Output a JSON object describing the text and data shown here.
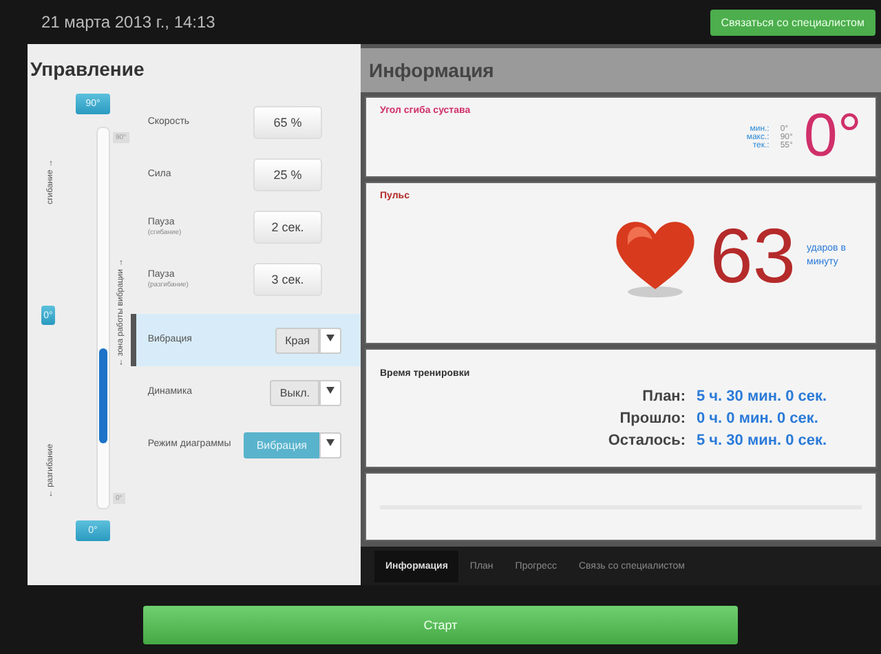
{
  "top_bar": {
    "datetime": "21 марта 2013 г., 14:13",
    "contact_button": "Связаться со специалистом"
  },
  "control": {
    "title": "Управление",
    "top_button": "90°",
    "bottom_button": "0°",
    "current_button": "0°",
    "flex_label": "сгибание →",
    "extend_label": "← разгибание",
    "zone_label": "← зона работы вибрации →",
    "top_tick": "90°",
    "bottom_tick": "0°",
    "zone": {
      "level": 0.25
    },
    "rows": [
      {
        "kind": "value",
        "label": "Скорость",
        "value": "65 %",
        "selected": false
      },
      {
        "kind": "value",
        "label": "Сила",
        "value": "25 %",
        "selected": false
      },
      {
        "kind": "value",
        "label": "Пауза",
        "sublabel": "(сгибание)",
        "value": "2 сек.",
        "selected": false
      },
      {
        "kind": "value",
        "label": "Пауза",
        "sublabel": "(разгибание)",
        "value": "3 сек.",
        "selected": false
      },
      {
        "kind": "select",
        "label": "Вибрация",
        "value": "Края",
        "selected": true,
        "highlighted": false
      },
      {
        "kind": "select",
        "label": "Динамика",
        "value": "Выкл.",
        "selected": false,
        "highlighted": false
      },
      {
        "kind": "select",
        "label": "Режим диаграммы",
        "value": "Вибрация",
        "selected": false,
        "highlighted": true
      }
    ]
  },
  "info": {
    "title": "Информация",
    "angle": {
      "title": "Угол сгиба сустава",
      "stats": [
        {
          "label": "мин.:",
          "value": "0°"
        },
        {
          "label": "макс.:",
          "value": "90°"
        },
        {
          "label": "тек.:",
          "value": "55°"
        }
      ],
      "value": "0°"
    },
    "pulse": {
      "title": "Пульс",
      "value": "63",
      "unit": "ударов в минуту"
    },
    "time": {
      "title": "Время тренировки",
      "rows": [
        {
          "label": "План:",
          "value": "5 ч. 30 мин. 0 сек."
        },
        {
          "label": "Прошло:",
          "value": "0 ч. 0 мин. 0 сек."
        },
        {
          "label": "Осталось:",
          "value": "5 ч. 30 мин. 0 сек."
        }
      ]
    },
    "tabs": [
      {
        "label": "Информация",
        "selected": true
      },
      {
        "label": "План",
        "selected": false
      },
      {
        "label": "Прогресс",
        "selected": false
      },
      {
        "label": "Связь со специалистом",
        "selected": false
      }
    ]
  },
  "start_button": "Старт"
}
